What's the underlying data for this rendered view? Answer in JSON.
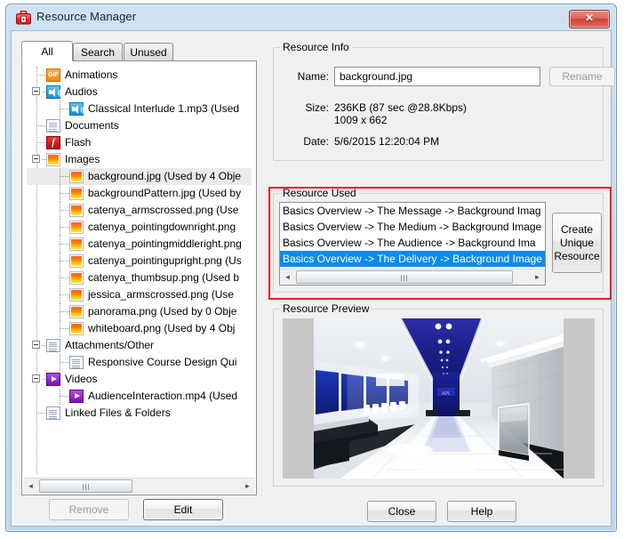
{
  "window": {
    "title": "Resource Manager",
    "icon": "toolbox-icon",
    "close_label": "✕",
    "accent_highlight": "#ec2024",
    "selection_color": "#0a8bec"
  },
  "tabs": [
    {
      "label": "All",
      "active": true
    },
    {
      "label": "Search",
      "active": false
    },
    {
      "label": "Unused",
      "active": false
    }
  ],
  "tree": {
    "items": [
      {
        "label": "Animations",
        "icon": "gif-icon",
        "depth": 0,
        "expander": "none",
        "selected": false
      },
      {
        "label": "Audios",
        "icon": "audio-icon",
        "depth": 0,
        "expander": "minus",
        "selected": false
      },
      {
        "label": "Classical Interlude 1.mp3 (Used",
        "icon": "audio-icon",
        "depth": 1,
        "expander": "none",
        "selected": false
      },
      {
        "label": "Documents",
        "icon": "document-icon",
        "depth": 0,
        "expander": "none",
        "selected": false
      },
      {
        "label": "Flash",
        "icon": "flash-icon",
        "depth": 0,
        "expander": "none",
        "selected": false
      },
      {
        "label": "Images",
        "icon": "image-icon",
        "depth": 0,
        "expander": "minus",
        "selected": false
      },
      {
        "label": "background.jpg (Used by 4 Obje",
        "icon": "image-icon",
        "depth": 1,
        "expander": "none",
        "selected": true
      },
      {
        "label": "backgroundPattern.jpg (Used by",
        "icon": "image-icon",
        "depth": 1,
        "expander": "none",
        "selected": false
      },
      {
        "label": "catenya_armscrossed.png (Use",
        "icon": "image-icon",
        "depth": 1,
        "expander": "none",
        "selected": false
      },
      {
        "label": "catenya_pointingdownright.png",
        "icon": "image-icon",
        "depth": 1,
        "expander": "none",
        "selected": false
      },
      {
        "label": "catenya_pointingmiddleright.png",
        "icon": "image-icon",
        "depth": 1,
        "expander": "none",
        "selected": false
      },
      {
        "label": "catenya_pointingupright.png (Us",
        "icon": "image-icon",
        "depth": 1,
        "expander": "none",
        "selected": false
      },
      {
        "label": "catenya_thumbsup.png (Used b",
        "icon": "image-icon",
        "depth": 1,
        "expander": "none",
        "selected": false
      },
      {
        "label": "jessica_armscrossed.png (Use",
        "icon": "image-icon",
        "depth": 1,
        "expander": "none",
        "selected": false
      },
      {
        "label": "panorama.png (Used by 0 Obje",
        "icon": "image-icon",
        "depth": 1,
        "expander": "none",
        "selected": false
      },
      {
        "label": "whiteboard.png (Used by 4 Obj",
        "icon": "image-icon",
        "depth": 1,
        "expander": "none",
        "selected": false
      },
      {
        "label": "Attachments/Other",
        "icon": "document-icon",
        "depth": 0,
        "expander": "minus",
        "selected": false
      },
      {
        "label": "Responsive Course Design Qui",
        "icon": "document-icon",
        "depth": 1,
        "expander": "none",
        "selected": false
      },
      {
        "label": "Videos",
        "icon": "video-icon",
        "depth": 0,
        "expander": "minus",
        "selected": false
      },
      {
        "label": "AudienceInteraction.mp4 (Used",
        "icon": "video-icon",
        "depth": 1,
        "expander": "none",
        "selected": false
      },
      {
        "label": "Linked Files & Folders",
        "icon": "document-icon",
        "depth": 0,
        "expander": "none",
        "selected": false
      }
    ]
  },
  "left_buttons": {
    "remove_label": "Remove",
    "remove_disabled": true,
    "edit_label": "Edit"
  },
  "resource_info": {
    "group_label": "Resource Info",
    "name_label": "Name:",
    "name_value": "background.jpg",
    "name_placeholder": "",
    "rename_label": "Rename",
    "rename_disabled": true,
    "size_label": "Size:",
    "size_value": "236KB (87 sec @28.8Kbps)",
    "dimensions_value": "1009 x 662",
    "date_label": "Date:",
    "date_value": "5/6/2015 12:20:04 PM"
  },
  "resource_used": {
    "group_label": "Resource Used",
    "rows": [
      {
        "text": "Basics Overview -> The Message -> Background Imag",
        "selected": false
      },
      {
        "text": "Basics Overview -> The Medium -> Background Image",
        "selected": false
      },
      {
        "text": "Basics Overview -> The Audience -> Background Ima",
        "selected": false
      },
      {
        "text": "Basics Overview -> The Delivery -> Background Image",
        "selected": true
      }
    ],
    "create_unique_label": "Create Unique Resource",
    "create_unique_lines": [
      "Create",
      "Unique",
      "Resource"
    ]
  },
  "resource_preview": {
    "group_label": "Resource Preview",
    "description": "Modern white office lobby with blue illuminated ceiling corridor, glass meeting room and reflective floor"
  },
  "dialog_buttons": {
    "close_label": "Close",
    "help_label": "Help"
  },
  "scrollbars": {
    "left_arrow_glyph": "◄",
    "right_arrow_glyph": "►"
  }
}
